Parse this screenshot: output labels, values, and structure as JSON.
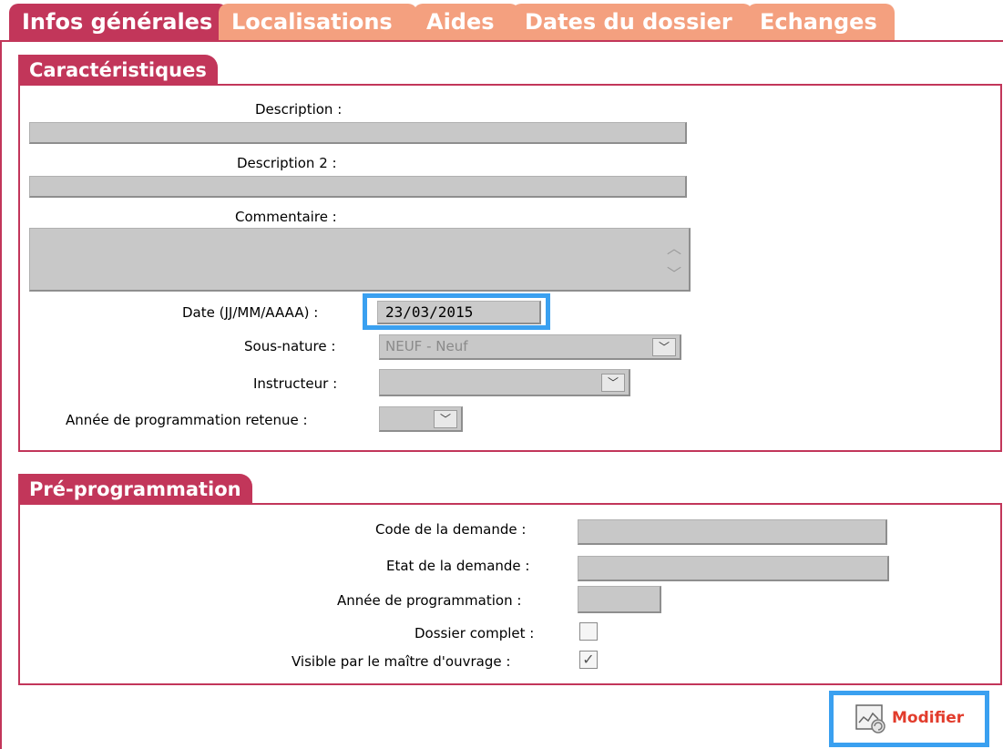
{
  "tabs": [
    {
      "label": "Infos générales",
      "active": true
    },
    {
      "label": "Localisations",
      "active": false
    },
    {
      "label": "Aides",
      "active": false
    },
    {
      "label": "Dates du dossier",
      "active": false
    },
    {
      "label": "Echanges",
      "active": false
    }
  ],
  "caracteristiques": {
    "title": "Caractéristiques",
    "description_label": "Description :",
    "description_value": "",
    "description2_label": "Description 2 :",
    "description2_value": "",
    "commentaire_label": "Commentaire :",
    "commentaire_value": "",
    "date_label": "Date (JJ/MM/AAAA) :",
    "date_value": "23/03/2015",
    "sous_nature_label": "Sous-nature :",
    "sous_nature_value": "NEUF - Neuf",
    "instructeur_label": "Instructeur :",
    "instructeur_value": "",
    "annee_retenue_label": "Année de programmation retenue :",
    "annee_retenue_value": ""
  },
  "preprogrammation": {
    "title": "Pré-programmation",
    "code_label": "Code de la demande :",
    "code_value": "",
    "etat_label": "Etat de la demande :",
    "etat_value": "",
    "annee_label": "Année de programmation :",
    "annee_value": "",
    "dossier_complet_label": "Dossier complet :",
    "dossier_complet_checked": false,
    "visible_label": "Visible par le maître d'ouvrage :",
    "visible_checked": true
  },
  "actions": {
    "modifier_label": "Modifier",
    "modifier_icon": "edit-document-icon"
  },
  "colors": {
    "accent": "#c2365a",
    "tab_inactive": "#f4a07f",
    "highlight": "#3aa0f0",
    "button_text": "#e23c2c"
  }
}
